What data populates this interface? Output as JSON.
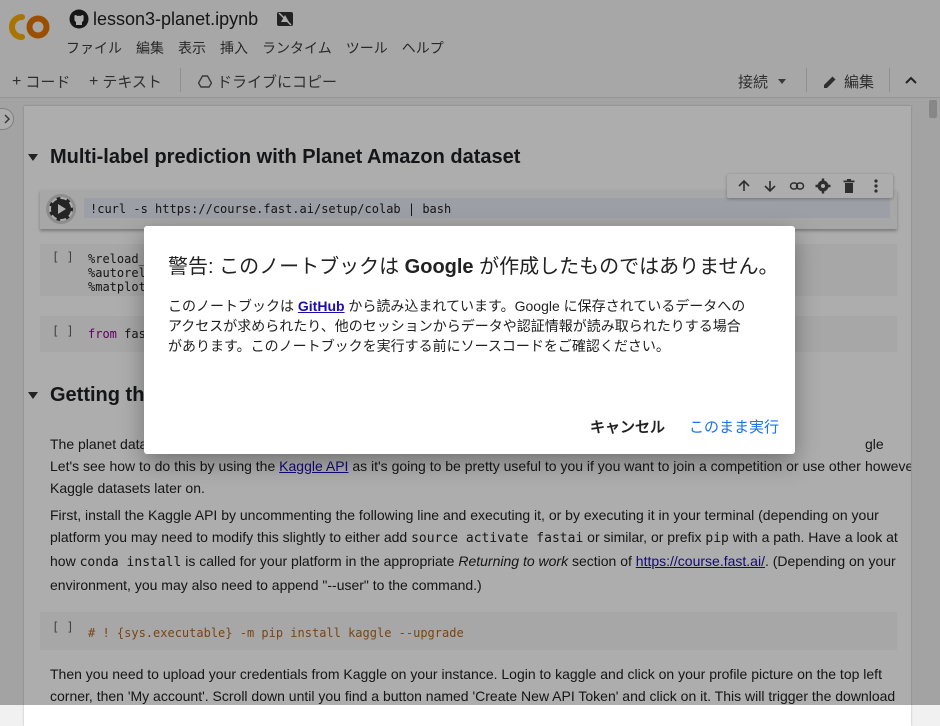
{
  "header": {
    "file_name": "lesson3-planet.ipynb",
    "menu": [
      "ファイル",
      "編集",
      "表示",
      "挿入",
      "ランタイム",
      "ツール",
      "ヘルプ"
    ]
  },
  "toolbar": {
    "add_code": "コード",
    "add_text": "テキスト",
    "copy_to_drive": "ドライブにコピー",
    "connect": "接続",
    "edit": "編集"
  },
  "notebook": {
    "heading1": "Multi-label prediction with Planet Amazon dataset",
    "run_cell_code": "!curl -s https://course.fast.ai/setup/colab | bash",
    "cell2_lines": [
      "%reload_e",
      "%autorelo",
      "%matplot"
    ],
    "cell3_kw": "from",
    "cell3_rest": " fast",
    "bracket": "[ ]",
    "heading2": "Getting th",
    "para1_line1_start": "The planet data",
    "para1_line1_end": "gle however.",
    "para1_line2_pre": "Let's see how to do this by using the ",
    "para1_link": "Kaggle API",
    "para1_line2_post": " as it's going to be pretty useful to you if you want to join a competition or use other",
    "para1_line3": "Kaggle datasets later on.",
    "para2_a": "First, install the Kaggle API by uncommenting the following line and executing it, or by executing it in your terminal (depending on your platform you may need to modify this slightly to either add ",
    "para2_code1": "source activate fastai",
    "para2_b": " or similar, or prefix ",
    "para2_code2": "pip",
    "para2_c": " with a path. Have a look at how ",
    "para2_code3": "conda install",
    "para2_d": " is called for your platform in the appropriate ",
    "para2_em": "Returning to work",
    "para2_e": " section of ",
    "para2_link": "https://course.fast.ai/",
    "para2_f": ". (Depending on your environment, you may also need to append \"--user\" to the command.)",
    "pip_code": "# ! {sys.executable} -m pip install kaggle --upgrade",
    "para3": "Then you need to upload your credentials from Kaggle on your instance. Login to kaggle and click on your profile picture on the top left corner, then 'My account'. Scroll down until you find a button named 'Create New API Token' and click on it. This will trigger the download"
  },
  "dialog": {
    "title_pre": "警告: このノートブックは ",
    "title_brand": "Google",
    "title_post": " が作成したものではありません。",
    "body_pre": "このノートブックは ",
    "body_link": "GitHub",
    "body_post": " から読み込まれています。Google に保存されているデータへのアクセスが求められたり、他のセッションからデータや認証情報が読み取られたりする場合があります。このノートブックを実行する前にソースコードをご確認ください。",
    "cancel_label": "キャンセル",
    "run_label": "このまま実行"
  },
  "colors": {
    "colab_orange": "#F9AB00",
    "colab_dark": "#E37400",
    "link_blue": "#1a73e8"
  },
  "icons": [
    "colab-logo-icon",
    "github-icon",
    "drive-warning-icon",
    "drive-icon",
    "chevron-down-icon",
    "pencil-icon",
    "chevron-up-icon",
    "sidebar-expand-icon",
    "run-icon",
    "arrow-up-icon",
    "arrow-down-icon",
    "link-icon",
    "gear-icon",
    "trash-icon",
    "more-vert-icon",
    "caret-down-icon"
  ]
}
